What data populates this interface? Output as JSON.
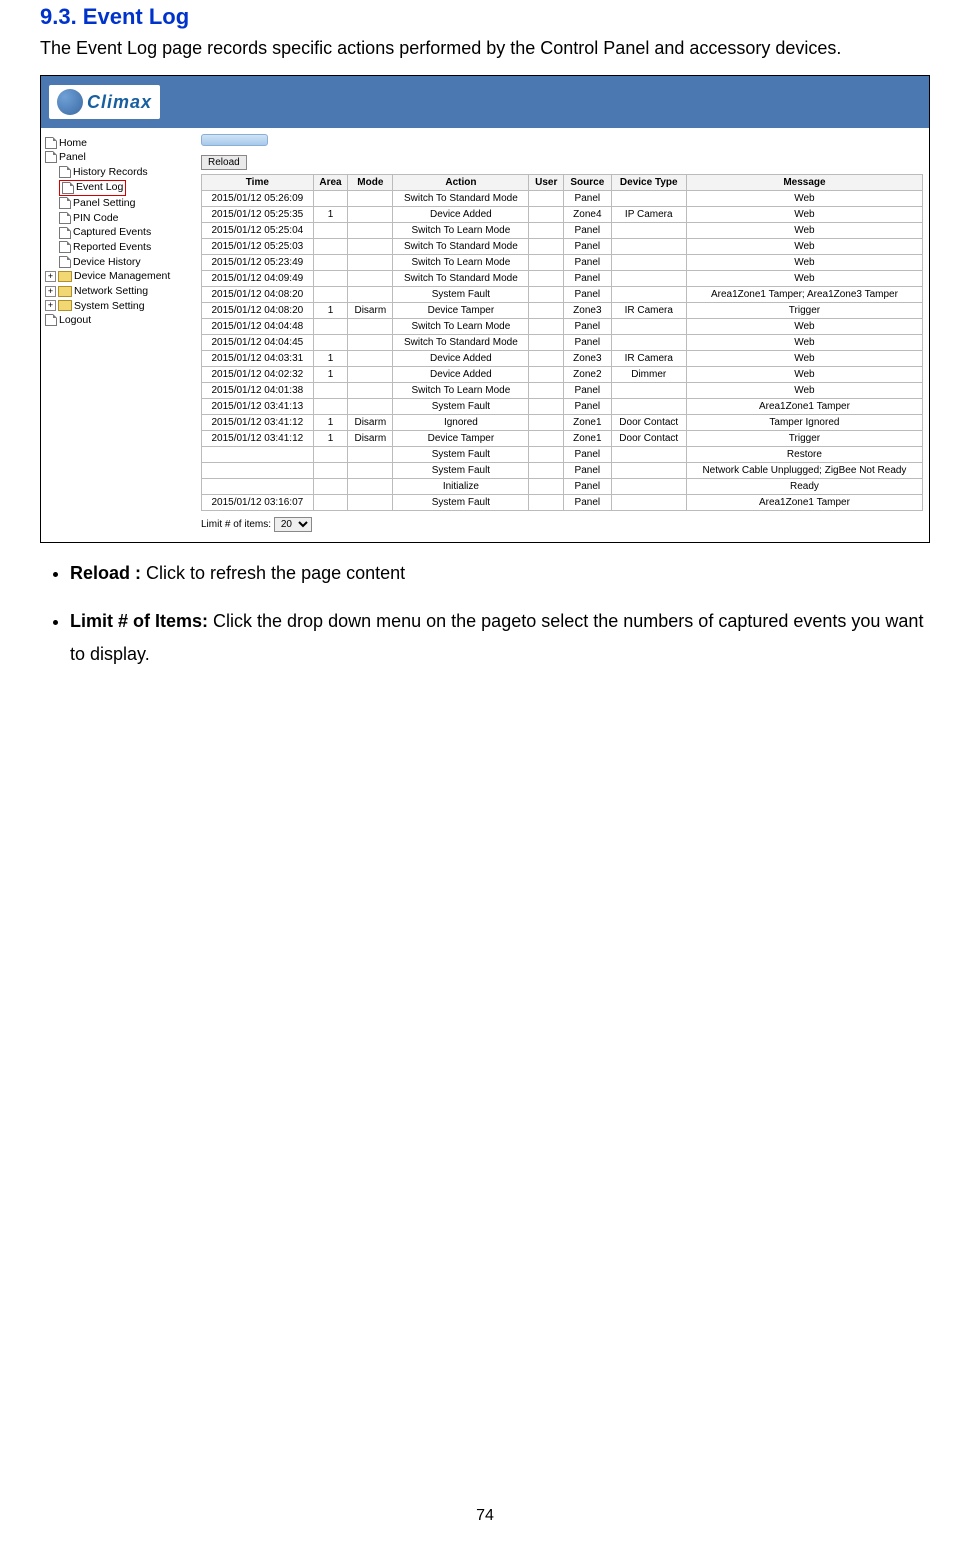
{
  "heading": "9.3. Event Log",
  "intro": "The Event Log page records specific actions performed by the Control Panel and accessory devices.",
  "logo_text": "Climax",
  "nav": {
    "home": "Home",
    "panel": "Panel",
    "history": "History Records",
    "event_log": "Event Log",
    "panel_setting": "Panel Setting",
    "pin": "PIN Code",
    "captured": "Captured Events",
    "reported": "Reported Events",
    "device_history": "Device History",
    "device_mgmt": "Device Management",
    "network": "Network Setting",
    "system": "System Setting",
    "logout": "Logout"
  },
  "reload_btn": "Reload",
  "table": {
    "headers": [
      "Time",
      "Area",
      "Mode",
      "Action",
      "User",
      "Source",
      "Device Type",
      "Message"
    ],
    "rows": [
      {
        "time": "2015/01/12 05:26:09",
        "area": "",
        "mode": "",
        "action": "Switch To Standard Mode",
        "user": "",
        "source": "Panel",
        "device": "",
        "message": "Web"
      },
      {
        "time": "2015/01/12 05:25:35",
        "area": "1",
        "mode": "",
        "action": "Device Added",
        "user": "",
        "source": "Zone4",
        "device": "IP Camera",
        "message": "Web"
      },
      {
        "time": "2015/01/12 05:25:04",
        "area": "",
        "mode": "",
        "action": "Switch To Learn Mode",
        "user": "",
        "source": "Panel",
        "device": "",
        "message": "Web"
      },
      {
        "time": "2015/01/12 05:25:03",
        "area": "",
        "mode": "",
        "action": "Switch To Standard Mode",
        "user": "",
        "source": "Panel",
        "device": "",
        "message": "Web"
      },
      {
        "time": "2015/01/12 05:23:49",
        "area": "",
        "mode": "",
        "action": "Switch To Learn Mode",
        "user": "",
        "source": "Panel",
        "device": "",
        "message": "Web"
      },
      {
        "time": "2015/01/12 04:09:49",
        "area": "",
        "mode": "",
        "action": "Switch To Standard Mode",
        "user": "",
        "source": "Panel",
        "device": "",
        "message": "Web"
      },
      {
        "time": "2015/01/12 04:08:20",
        "area": "",
        "mode": "",
        "action": "System Fault",
        "user": "",
        "source": "Panel",
        "device": "",
        "message": "Area1Zone1 Tamper; Area1Zone3 Tamper"
      },
      {
        "time": "2015/01/12 04:08:20",
        "area": "1",
        "mode": "Disarm",
        "action": "Device Tamper",
        "user": "",
        "source": "Zone3",
        "device": "IR Camera",
        "message": "Trigger"
      },
      {
        "time": "2015/01/12 04:04:48",
        "area": "",
        "mode": "",
        "action": "Switch To Learn Mode",
        "user": "",
        "source": "Panel",
        "device": "",
        "message": "Web"
      },
      {
        "time": "2015/01/12 04:04:45",
        "area": "",
        "mode": "",
        "action": "Switch To Standard Mode",
        "user": "",
        "source": "Panel",
        "device": "",
        "message": "Web"
      },
      {
        "time": "2015/01/12 04:03:31",
        "area": "1",
        "mode": "",
        "action": "Device Added",
        "user": "",
        "source": "Zone3",
        "device": "IR Camera",
        "message": "Web"
      },
      {
        "time": "2015/01/12 04:02:32",
        "area": "1",
        "mode": "",
        "action": "Device Added",
        "user": "",
        "source": "Zone2",
        "device": "Dimmer",
        "message": "Web"
      },
      {
        "time": "2015/01/12 04:01:38",
        "area": "",
        "mode": "",
        "action": "Switch To Learn Mode",
        "user": "",
        "source": "Panel",
        "device": "",
        "message": "Web"
      },
      {
        "time": "2015/01/12 03:41:13",
        "area": "",
        "mode": "",
        "action": "System Fault",
        "user": "",
        "source": "Panel",
        "device": "",
        "message": "Area1Zone1 Tamper"
      },
      {
        "time": "2015/01/12 03:41:12",
        "area": "1",
        "mode": "Disarm",
        "action": "Ignored",
        "user": "",
        "source": "Zone1",
        "device": "Door Contact",
        "message": "Tamper Ignored"
      },
      {
        "time": "2015/01/12 03:41:12",
        "area": "1",
        "mode": "Disarm",
        "action": "Device Tamper",
        "user": "",
        "source": "Zone1",
        "device": "Door Contact",
        "message": "Trigger"
      },
      {
        "time": "",
        "area": "",
        "mode": "",
        "action": "System Fault",
        "user": "",
        "source": "Panel",
        "device": "",
        "message": "Restore"
      },
      {
        "time": "",
        "area": "",
        "mode": "",
        "action": "System Fault",
        "user": "",
        "source": "Panel",
        "device": "",
        "message": "Network Cable Unplugged; ZigBee Not Ready"
      },
      {
        "time": "",
        "area": "",
        "mode": "",
        "action": "Initialize",
        "user": "",
        "source": "Panel",
        "device": "",
        "message": "Ready"
      },
      {
        "time": "2015/01/12 03:16:07",
        "area": "",
        "mode": "",
        "action": "System Fault",
        "user": "",
        "source": "Panel",
        "device": "",
        "message": "Area1Zone1 Tamper"
      }
    ]
  },
  "limit_label": "Limit # of items:",
  "limit_value": "20",
  "bullets": {
    "reload_label": "Reload :",
    "reload_text": " Click to refresh the page content",
    "limit_label": "Limit # of Items:",
    "limit_text": " Click the drop down menu on the pageto select the numbers of captured events you want to display."
  },
  "page_number": "74"
}
